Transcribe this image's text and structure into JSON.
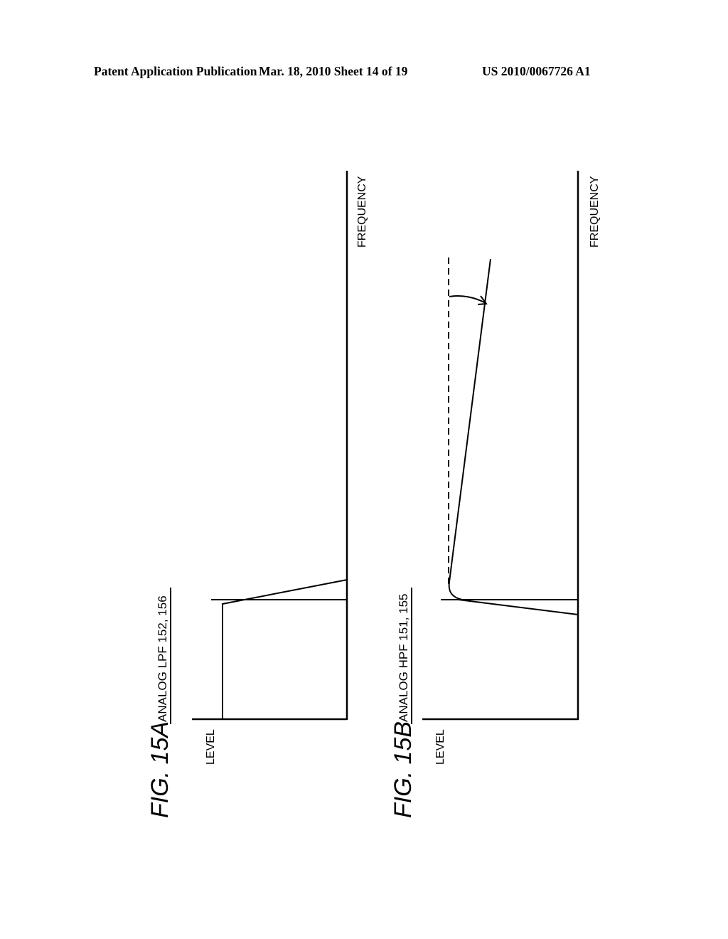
{
  "header": {
    "left": "Patent Application Publication",
    "middle": "Mar. 18, 2010  Sheet 14 of 19",
    "right": "US 2010/0067726 A1"
  },
  "figures": [
    {
      "id": "fig15a",
      "label": "FIG. 15A",
      "title": "ANALOG LPF 152, 156",
      "level_axis_label": "LEVEL",
      "frequency_axis_label": "FREQUENCY",
      "description": "Low-pass characteristic: flat level then sloped line crossing cutoff"
    },
    {
      "id": "fig15b",
      "label": "FIG. 15B",
      "title": "ANALOG HPF 151, 155",
      "level_axis_label": "LEVEL",
      "frequency_axis_label": "FREQUENCY",
      "description": "High-pass characteristic with dashed reference and tilted response indicated by curved arrow"
    }
  ]
}
